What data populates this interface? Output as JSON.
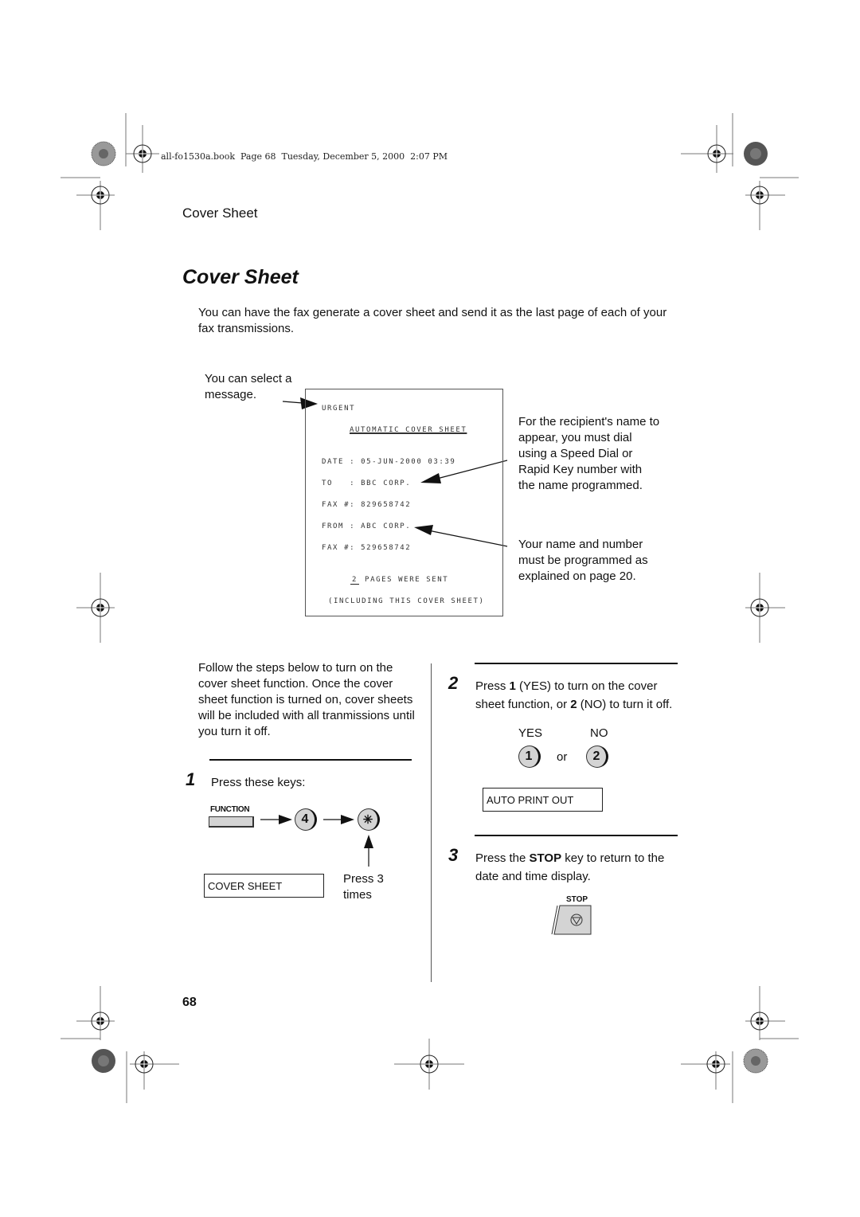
{
  "file_header": "all-fo1530a.book  Page 68  Tuesday, December 5, 2000  2:07 PM",
  "running_head": "Cover Sheet",
  "page_title": "Cover Sheet",
  "intro": "You can have the fax generate a cover sheet and send it as the last page of each of your fax transmissions.",
  "figure": {
    "left_caption": "You can select a message.",
    "fax_sheet": {
      "message": "URGENT",
      "title": "AUTOMATIC COVER SHEET",
      "date_line": "DATE : 05-JUN-2000 03:39",
      "to_line": "TO   : BBC CORP.",
      "to_fax_line": "FAX #: 829658742",
      "from_line": "FROM : ABC CORP.",
      "from_fax_line": "FAX #: 529658742",
      "pages_count": "2",
      "pages_text": " PAGES WERE SENT",
      "including_line": "(INCLUDING THIS COVER SHEET)"
    },
    "note_recipient": "For the recipient's name to appear, you must dial using a Speed Dial or Rapid Key number with the name programmed.",
    "note_sender": "Your name and number must be programmed as explained on page 20."
  },
  "left_column": {
    "intro": "Follow the steps below to turn on the cover sheet function. Once the cover sheet function is turned on, cover sheets will be included with all tranmissions until you turn it off.",
    "step1": {
      "number": "1",
      "text": "Press these keys:",
      "function_key_label": "FUNCTION",
      "key_4": "4",
      "key_star": "✳",
      "display": "COVER SHEET",
      "press_note": "Press 3 times"
    }
  },
  "right_column": {
    "step2": {
      "number": "2",
      "text_before_1": "Press ",
      "bold_1": "1",
      "text_mid": " (YES) to turn on the cover sheet function, or ",
      "bold_2": "2",
      "text_after": " (NO) to turn it off.",
      "yes_label": "YES",
      "no_label": "NO",
      "key_1": "1",
      "or_label": "or",
      "key_2": "2",
      "display": "AUTO PRINT OUT"
    },
    "step3": {
      "number": "3",
      "text_before": "Press the ",
      "bold": "STOP",
      "text_after": " key to return to the date and time display.",
      "stop_label": "STOP"
    }
  },
  "page_number": "68"
}
